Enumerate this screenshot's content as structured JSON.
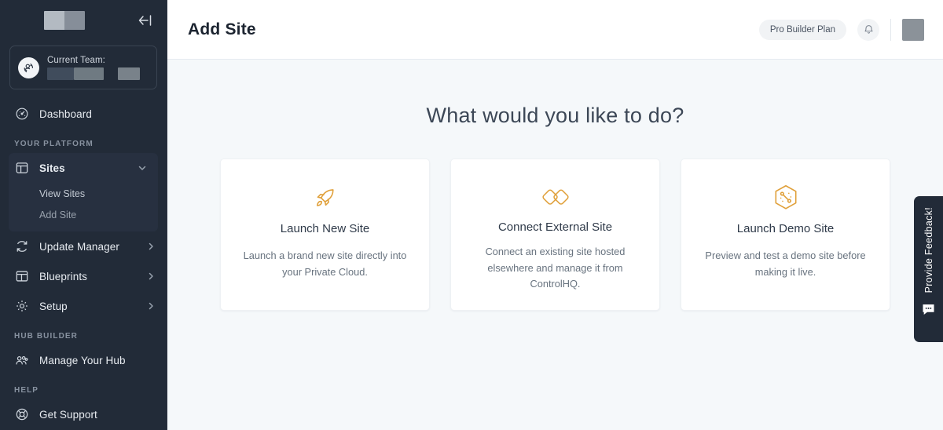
{
  "sidebar": {
    "logo": "logo-redacted",
    "collapse_icon": "collapse-left-icon",
    "team": {
      "icon": "switch-team-icon",
      "label": "Current Team:",
      "value_redacted": "redacted"
    },
    "dashboard": {
      "label": "Dashboard",
      "icon": "speedometer-icon"
    },
    "section_platform": "YOUR PLATFORM",
    "sites": {
      "label": "Sites",
      "icon": "layout-panels-icon",
      "chevron": "chevron-down-icon",
      "children": [
        {
          "label": "View Sites"
        },
        {
          "label": "Add Site"
        }
      ]
    },
    "items": [
      {
        "label": "Update Manager",
        "icon": "refresh-icon",
        "chevron": "chevron-right-icon"
      },
      {
        "label": "Blueprints",
        "icon": "blueprint-grid-icon",
        "chevron": "chevron-right-icon"
      },
      {
        "label": "Setup",
        "icon": "gear-icon",
        "chevron": "chevron-right-icon"
      }
    ],
    "section_hub": "HUB BUILDER",
    "hub": {
      "label": "Manage Your Hub",
      "icon": "people-group-icon"
    },
    "section_help": "HELP",
    "support": {
      "label": "Get Support",
      "icon": "lifebuoy-icon"
    }
  },
  "topbar": {
    "title": "Add Site",
    "plan_badge": "Pro Builder Plan",
    "bell_icon": "bell-icon",
    "avatar": "avatar-redacted"
  },
  "content": {
    "headline": "What would you like to do?",
    "cards": [
      {
        "icon": "rocket-icon",
        "title": "Launch New Site",
        "desc": "Launch a brand new site directly into your Private Cloud."
      },
      {
        "icon": "link-chain-icon",
        "title": "Connect External Site",
        "desc": "Connect an existing site hosted elsewhere and manage it from ControlHQ."
      },
      {
        "icon": "hexagon-molecule-icon",
        "title": "Launch Demo Site",
        "desc": "Preview and test a demo site before making it live."
      }
    ]
  },
  "feedback": {
    "label": "Provide Feedback!",
    "icon": "speech-bubble-icon"
  },
  "colors": {
    "sidebar_bg": "#222b38",
    "sidebar_active": "#273040",
    "main_bg": "#f5f8fa",
    "accent_orange": "#e0a03a",
    "title_text": "#1c2430"
  }
}
